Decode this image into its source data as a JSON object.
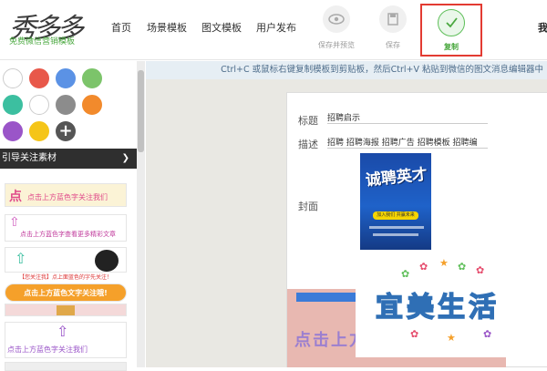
{
  "logo": {
    "main": "秀多多",
    "sub": "免费微信营销模板"
  },
  "nav": [
    {
      "label": "首页"
    },
    {
      "label": "场景模板"
    },
    {
      "label": "图文模板"
    },
    {
      "label": "用户发布"
    }
  ],
  "tools": {
    "preview": {
      "label": "保存并预览",
      "icon": "eye-icon"
    },
    "save": {
      "label": "保存",
      "icon": "save-icon"
    },
    "copy": {
      "label": "复制",
      "icon": "check-icon",
      "highlight_color": "#e33b32"
    }
  },
  "user_short": "我",
  "swatch_colors": [
    "#ffffff",
    "#e8584a",
    "#5b92e5",
    "#7cc46a",
    "#3cbfa0",
    "#ffffff",
    "#8c8c8c",
    "#f28a2c",
    "#9a55c8",
    "#f5c518"
  ],
  "section_header": "引导关注素材",
  "templates": [
    {
      "text": "点击上方蓝色字关注我们"
    },
    {
      "text": "点击上方蓝色字查看更多精彩文章"
    },
    {
      "text": ""
    },
    {
      "text": "【您关注我】点上面蓝色的字先关注！"
    },
    {
      "text": "点击上方蓝色文字关注哦!"
    },
    {
      "text": ""
    },
    {
      "text": "点击上方蓝色字关注我们"
    }
  ],
  "hint": "Ctrl+C 或鼠标右键复制模板到剪贴板，然后Ctrl+V 粘贴到微信的图文消息编辑器中",
  "form": {
    "title_label": "标题",
    "title_value": "招聘启示",
    "desc_label": "描述",
    "desc_value": "招聘 招聘海报 招聘广告 招聘模板 招聘编",
    "cover_label": "封面"
  },
  "cover": {
    "title": "诚聘英才",
    "button": "加入我们 共赢未来"
  },
  "preview": {
    "text": "点击上方"
  },
  "watermark": {
    "text": "宜美生活"
  }
}
